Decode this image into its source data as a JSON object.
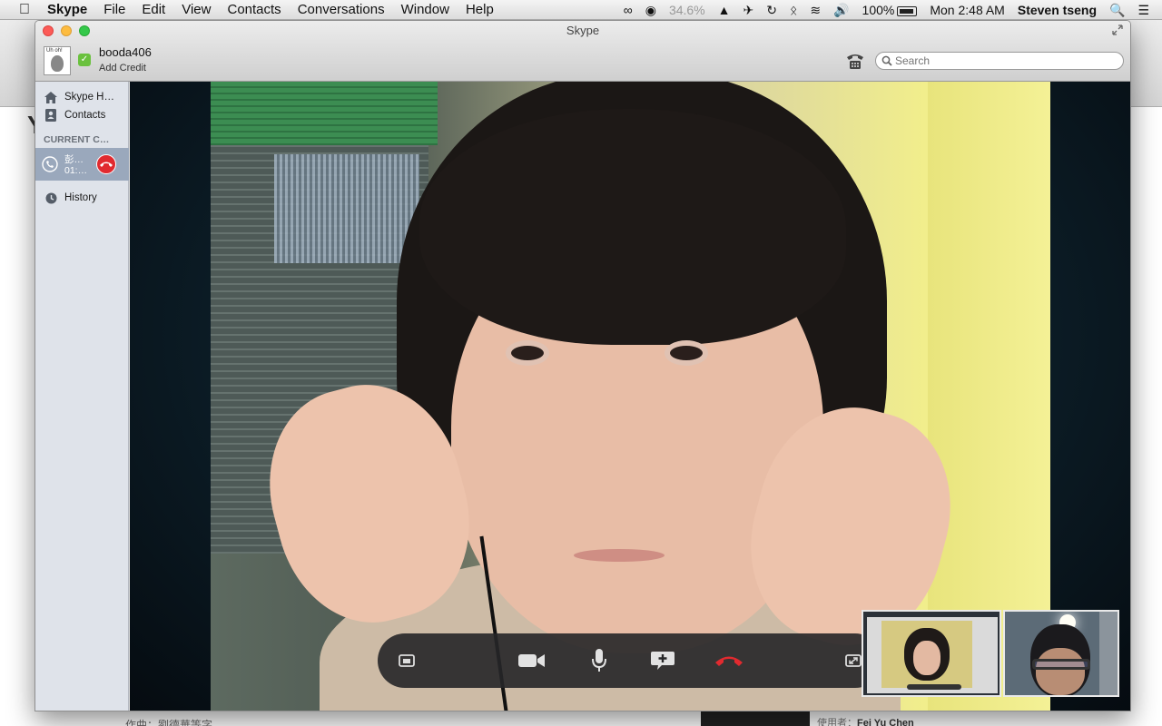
{
  "menubar": {
    "app_name": "Skype",
    "menus": [
      "File",
      "Edit",
      "View",
      "Contacts",
      "Conversations",
      "Window",
      "Help"
    ],
    "cpu_readout": "34.6%",
    "battery": "100%",
    "clock": "Mon 2:48 AM",
    "user": "Steven tseng"
  },
  "window": {
    "title": "Skype"
  },
  "account": {
    "username": "booda406",
    "add_credit": "Add Credit",
    "status": "online"
  },
  "search": {
    "placeholder": "Search"
  },
  "sidebar": {
    "items": [
      {
        "label": "Skype H…",
        "icon": "home-icon"
      },
      {
        "label": "Contacts",
        "icon": "contacts-icon"
      }
    ],
    "section_header": "CURRENT C…",
    "current_call": {
      "name": "彭…",
      "duration": "01:…"
    },
    "history_label": "History"
  },
  "call_controls": [
    "share-screen",
    "video",
    "microphone",
    "add-participant",
    "hang-up",
    "fullscreen"
  ],
  "background": {
    "footer_text": "作曲：劉德華等字",
    "footer_user_prefix": "使用者：",
    "footer_user_name": "Fei Yu Chen"
  },
  "colors": {
    "hangup_red": "#e12a2f",
    "online_green": "#6ac13e",
    "sidebar_selected": "#9aa8bc"
  }
}
